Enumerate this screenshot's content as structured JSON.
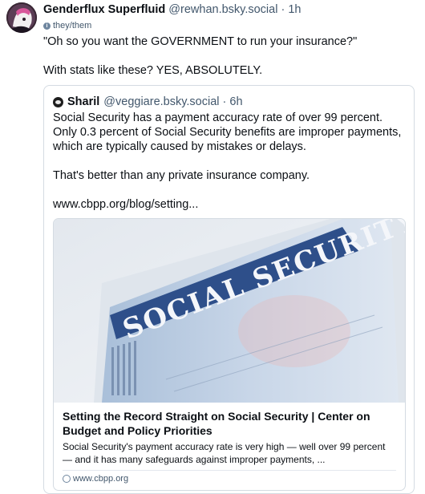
{
  "post": {
    "author_name": "Genderflux Superfluid",
    "author_handle": "@rewhan.bsky.social",
    "separator": " · ",
    "time": "1h",
    "pronouns": "they/them",
    "text_line1": "\"Oh so you want the GOVERNMENT to run your insurance?\"",
    "text_line2": "With stats like these? YES, ABSOLUTELY."
  },
  "quote": {
    "author_name": "Sharil",
    "author_handle": "@veggiare.bsky.social",
    "separator": " · ",
    "time": "6h",
    "paragraph1": "Social Security has a payment accuracy rate of over 99 percent. Only 0.3 percent of Social Security benefits are improper payments, which are typically caused by mistakes or delays.",
    "paragraph2": "That's better than any private insurance company.",
    "link": "www.cbpp.org/blog/setting...",
    "card": {
      "image_text": "SOCIAL SECURITY",
      "title": "Setting the Record Straight on Social Security | Center on Budget and Policy Priorities",
      "description": "Social Security's payment accuracy rate is very high — well over 99 percent — and it has many safeguards against improper payments, ...",
      "domain": "www.cbpp.org"
    }
  }
}
